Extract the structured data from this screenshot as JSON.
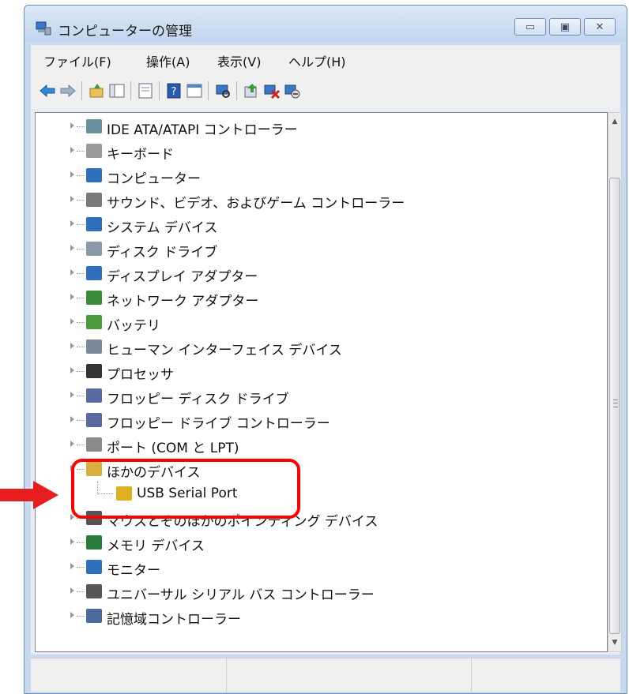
{
  "window": {
    "title": "コンピューターの管理",
    "controls": {
      "minimize": "▭",
      "maximize": "▣",
      "close": "✕"
    }
  },
  "menu": [
    {
      "label": "ファイル(F)"
    },
    {
      "label": "操作(A)"
    },
    {
      "label": "表示(V)"
    },
    {
      "label": "ヘルプ(H)"
    }
  ],
  "toolbar_icons": [
    "back-arrow-icon",
    "forward-arrow-icon",
    "up-folder-icon",
    "console-tree-icon",
    "properties-icon",
    "help-icon",
    "view-icon",
    "scan-hardware-icon",
    "update-driver-icon",
    "uninstall-icon",
    "disable-device-icon"
  ],
  "tree": {
    "items": [
      {
        "label": "IDE ATA/ATAPI コントローラー",
        "icon": "ide-controller-icon",
        "color": "#6a8f9e"
      },
      {
        "label": "キーボード",
        "icon": "keyboard-icon",
        "color": "#9a9a9a"
      },
      {
        "label": "コンピューター",
        "icon": "computer-icon",
        "color": "#2f6fc0"
      },
      {
        "label": "サウンド、ビデオ、およびゲーム コントローラー",
        "icon": "speaker-icon",
        "color": "#7a7a7a"
      },
      {
        "label": "システム デバイス",
        "icon": "system-device-icon",
        "color": "#2f6fc0"
      },
      {
        "label": "ディスク ドライブ",
        "icon": "disk-drive-icon",
        "color": "#8a9aa8"
      },
      {
        "label": "ディスプレイ アダプター",
        "icon": "display-adapter-icon",
        "color": "#2f6fc0"
      },
      {
        "label": "ネットワーク アダプター",
        "icon": "network-adapter-icon",
        "color": "#3a8a3a"
      },
      {
        "label": "バッテリ",
        "icon": "battery-icon",
        "color": "#4a9a3a"
      },
      {
        "label": "ヒューマン インターフェイス デバイス",
        "icon": "hid-icon",
        "color": "#7a8a9a"
      },
      {
        "label": "プロセッサ",
        "icon": "processor-icon",
        "color": "#333333"
      },
      {
        "label": "フロッピー ディスク ドライブ",
        "icon": "floppy-drive-icon",
        "color": "#5a6aa0"
      },
      {
        "label": "フロッピー ドライブ コントローラー",
        "icon": "floppy-controller-icon",
        "color": "#5a6aa0"
      },
      {
        "label": "ポート (COM と LPT)",
        "icon": "port-icon",
        "color": "#8a8a8a"
      },
      {
        "label": "ほかのデバイス",
        "icon": "unknown-device-icon",
        "color": "#d8b040"
      },
      {
        "label": "USB Serial Port",
        "icon": "warning-device-icon",
        "color": "#e0b020",
        "child": true
      },
      {
        "label": "マウスとそのほかのポインティング デバイス",
        "icon": "mouse-icon",
        "color": "#555555"
      },
      {
        "label": "メモリ デバイス",
        "icon": "memory-icon",
        "color": "#2a7a3a"
      },
      {
        "label": "モニター",
        "icon": "monitor-icon",
        "color": "#2f6fc0"
      },
      {
        "label": "ユニバーサル シリアル バス コントローラー",
        "icon": "usb-icon",
        "color": "#555555"
      },
      {
        "label": "記憶域コントローラー",
        "icon": "storage-controller-icon",
        "color": "#4a6aa0"
      }
    ]
  }
}
